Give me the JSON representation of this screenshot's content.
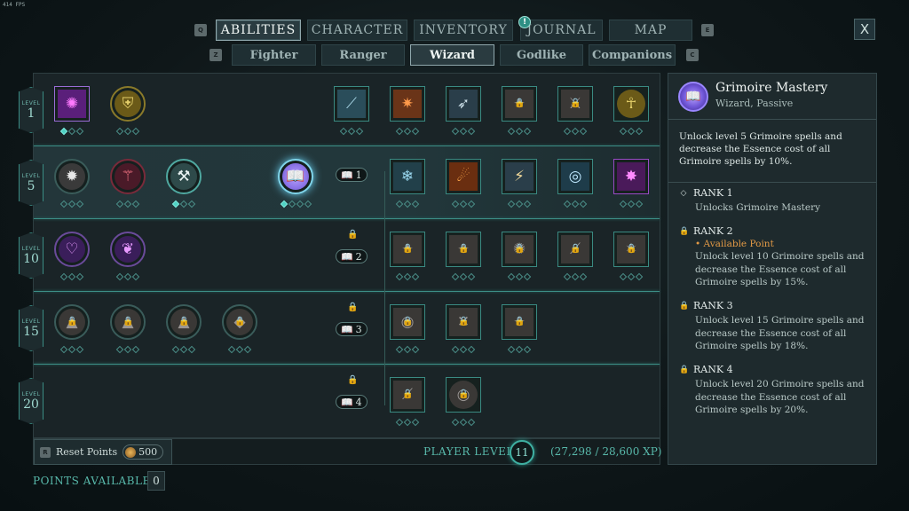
{
  "fps": "414 FPS",
  "tabs": {
    "key_left": "Q",
    "key_right": "E",
    "main": [
      "ABILITIES",
      "CHARACTER",
      "INVENTORY",
      "JOURNAL",
      "MAP"
    ],
    "journal_badge": "!",
    "close": "X",
    "sub_key_left": "Z",
    "sub_key_right": "C",
    "sub": [
      "Fighter",
      "Ranger",
      "Wizard",
      "Godlike",
      "Companions"
    ]
  },
  "levels": [
    {
      "t": "LEVEL",
      "n": "1"
    },
    {
      "t": "LEVEL",
      "n": "5"
    },
    {
      "t": "LEVEL",
      "n": "10"
    },
    {
      "t": "LEVEL",
      "n": "15"
    },
    {
      "t": "LEVEL",
      "n": "20"
    }
  ],
  "grimoire_nodes": [
    "1",
    "2",
    "3",
    "4"
  ],
  "bottom": {
    "reset_key": "R",
    "reset_label": "Reset Points",
    "reset_cost": "500",
    "player_level_label": "PLAYER LEVEL",
    "player_level": "11",
    "xp": "(27,298 / 28,600 XP)",
    "points_label": "POINTS AVAILABLE",
    "points_value": "0"
  },
  "detail": {
    "title": "Grimoire Mastery",
    "subtitle": "Wizard, Passive",
    "description": "Unlock level 5 Grimoire spells and decrease the Essence cost of all Grimoire spells by 10%.",
    "ranks": [
      {
        "name": "RANK 1",
        "status": "",
        "text": "Unlocks Grimoire Mastery"
      },
      {
        "name": "RANK 2",
        "status": "• Available Point",
        "text": "Unlock level 10 Grimoire spells and decrease the Essence cost of all Grimoire spells by 15%."
      },
      {
        "name": "RANK 3",
        "status": "",
        "text": "Unlock level 15 Grimoire spells and decrease the Essence cost of all Grimoire spells by 18%."
      },
      {
        "name": "RANK 4",
        "status": "",
        "text": "Unlock level 20 Grimoire spells and decrease the Essence cost of all Grimoire spells by 20%."
      }
    ]
  },
  "colors": {
    "accent": "#3c8e86",
    "lock": "#e2a34c",
    "selected_glow": "#7fd3e8"
  }
}
